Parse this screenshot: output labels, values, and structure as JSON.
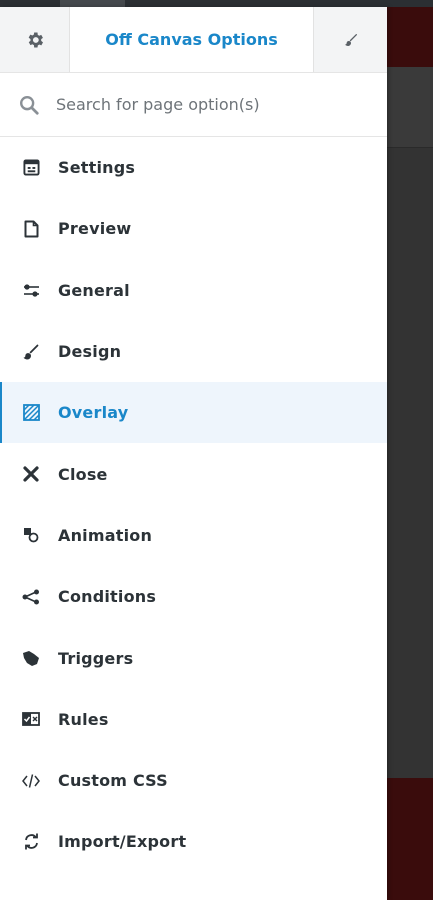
{
  "header": {
    "title": "Off Canvas Options",
    "left_icon": "gear-icon",
    "right_icon": "brush-icon"
  },
  "search": {
    "placeholder": "Search for page option(s)",
    "value": ""
  },
  "menu": {
    "active": "Overlay",
    "items": [
      {
        "label": "Settings",
        "icon": "settings-panel-icon"
      },
      {
        "label": "Preview",
        "icon": "document-icon"
      },
      {
        "label": "General",
        "icon": "sliders-icon"
      },
      {
        "label": "Design",
        "icon": "paint-brush-icon"
      },
      {
        "label": "Overlay",
        "icon": "overlay-hatch-icon"
      },
      {
        "label": "Close",
        "icon": "close-icon"
      },
      {
        "label": "Animation",
        "icon": "animation-shapes-icon"
      },
      {
        "label": "Conditions",
        "icon": "conditions-branch-icon"
      },
      {
        "label": "Triggers",
        "icon": "pointer-hand-icon"
      },
      {
        "label": "Rules",
        "icon": "rules-checkbox-icon"
      },
      {
        "label": "Custom CSS",
        "icon": "code-icon"
      },
      {
        "label": "Import/Export",
        "icon": "sync-arrows-icon"
      }
    ]
  },
  "colors": {
    "accent": "#1a87c9",
    "text": "#2c3338",
    "active_bg": "#eef5fc",
    "header_btn_bg": "#f3f4f5",
    "backdrop": "#333333",
    "site_brand": "#3a0c0c"
  }
}
